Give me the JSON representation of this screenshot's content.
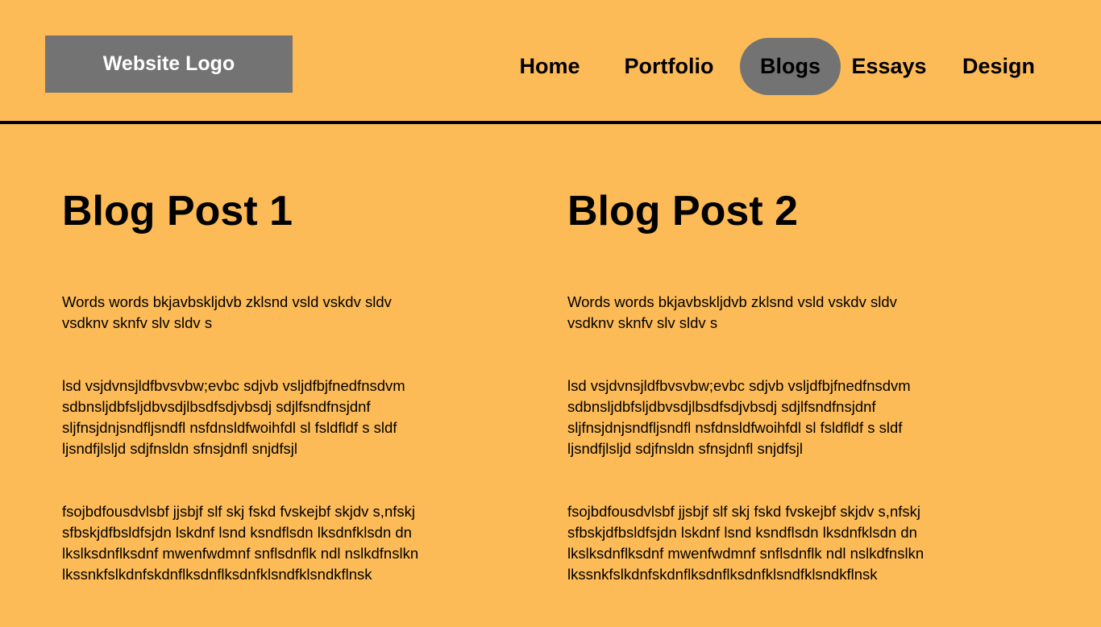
{
  "header": {
    "logo": "Website Logo",
    "nav": [
      {
        "label": "Home"
      },
      {
        "label": "Portfolio"
      },
      {
        "label": "Blogs",
        "active": true
      },
      {
        "label": "Essays"
      },
      {
        "label": "Design"
      }
    ]
  },
  "colors": {
    "background": "#FDBB57",
    "logo_bg": "#737373",
    "active_nav_bg": "#737373",
    "divider": "#000000"
  },
  "posts": [
    {
      "title": "Blog Post 1",
      "paragraphs": [
        "Words words  bkjavbskljdvb zklsnd vsld vskdv sldv\nvsdknv sknfv slv sldv s",
        " lsd vsjdvnsjldfbvsvbw;evbc sdjvb vsljdfbjfnedfnsdvm\nsdbnsljdbfsljdbvsdjlbsdfsdjvbsdj sdjlfsndfnsjdnf\nsljfnsjdnjsndfljsndfl nsfdnsldfwoihfdl sl fsldfldf s sldf\nljsndfjlsljd sdjfnsldn  sfnsjdnfl snjdfsjl",
        "fsojbdfousdvlsbf jjsbjf slf skj fskd fvskejbf skjdv s,nfskj\nsfbskjdfbsldfsjdn lskdnf lsnd ksndflsdn lksdnfklsdn dn\nlkslksdnflksdnf mwenfwdmnf snflsdnflk ndl nslkdfnslkn\nlkssnkfslkdnfskdnflksdnflksdnfklsndfklsndkflnsk"
      ]
    },
    {
      "title": "Blog Post 2",
      "paragraphs": [
        "Words words  bkjavbskljdvb zklsnd vsld vskdv sldv\nvsdknv sknfv slv sldv s",
        " lsd vsjdvnsjldfbvsvbw;evbc sdjvb vsljdfbjfnedfnsdvm\nsdbnsljdbfsljdbvsdjlbsdfsdjvbsdj sdjlfsndfnsjdnf\nsljfnsjdnjsndfljsndfl nsfdnsldfwoihfdl sl fsldfldf s sldf\nljsndfjlsljd sdjfnsldn  sfnsjdnfl snjdfsjl",
        "fsojbdfousdvlsbf jjsbjf slf skj fskd fvskejbf skjdv s,nfskj\nsfbskjdfbsldfsjdn lskdnf lsnd ksndflsdn lksdnfklsdn dn\nlkslksdnflksdnf mwenfwdmnf snflsdnflk ndl nslkdfnslkn\nlkssnkfslkdnfskdnflksdnflksdnfklsndfklsndkflnsk"
      ]
    }
  ]
}
